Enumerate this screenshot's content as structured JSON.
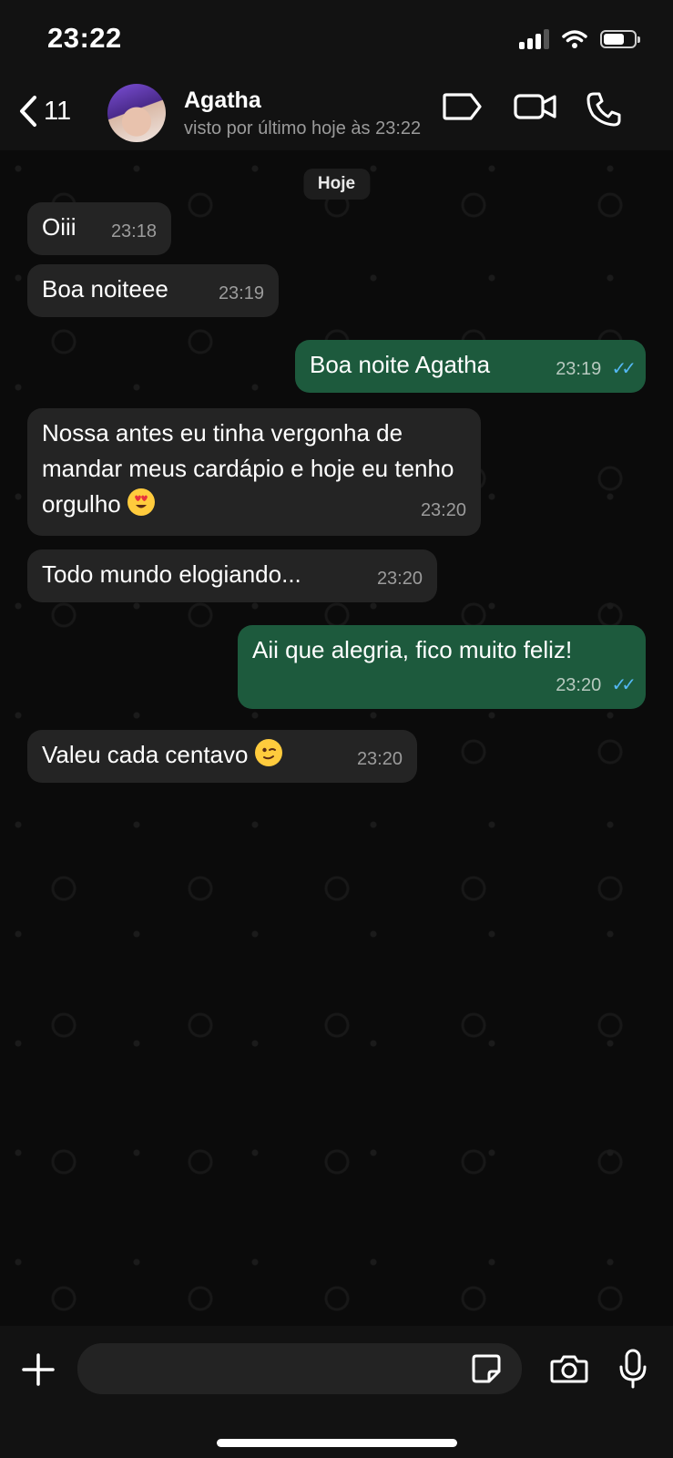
{
  "status_bar": {
    "time": "23:22"
  },
  "header": {
    "back_count": "11",
    "contact_name": "Agatha",
    "last_seen": "visto por último hoje às 23:22"
  },
  "chat": {
    "day_label": "Hoje",
    "messages": [
      {
        "direction": "in",
        "text": "Oiii",
        "time": "23:18"
      },
      {
        "direction": "in",
        "text": "Boa noiteee",
        "time": "23:19"
      },
      {
        "direction": "out",
        "text": "Boa noite  Agatha",
        "time": "23:19",
        "read": true
      },
      {
        "direction": "in",
        "text": "Nossa antes eu tinha vergonha de mandar meus cardápio e hoje eu tenho orgulho",
        "emoji": "heart-eyes",
        "time": "23:20"
      },
      {
        "direction": "in",
        "text": "Todo mundo elogiando...",
        "time": "23:20"
      },
      {
        "direction": "out",
        "text": "Aii que alegria, fico muito feliz!",
        "time": "23:20",
        "read": true
      },
      {
        "direction": "in",
        "text": "Valeu cada centavo",
        "emoji": "winking-face",
        "time": "23:20"
      }
    ]
  },
  "composer": {
    "placeholder": ""
  },
  "colors": {
    "incoming": "#242424",
    "outgoing": "#1d5a3d",
    "read_ticks": "#54b8f4"
  }
}
